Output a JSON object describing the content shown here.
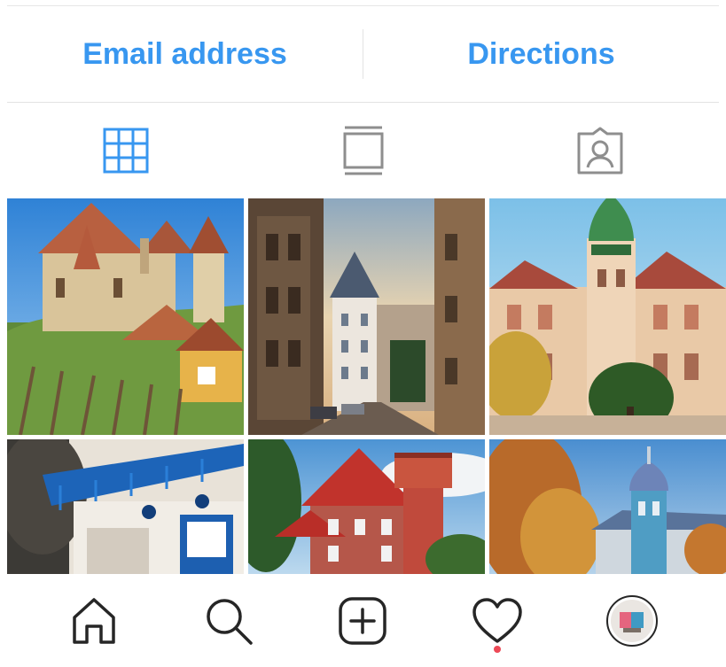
{
  "contact": {
    "email_label": "Email address",
    "directions_label": "Directions"
  },
  "tabs": [
    {
      "name": "grid",
      "icon": "grid-icon",
      "active": true
    },
    {
      "name": "feed",
      "icon": "feed-view-icon",
      "active": false
    },
    {
      "name": "tagged",
      "icon": "tagged-person-icon",
      "active": false
    }
  ],
  "colors": {
    "accent": "#3897f0",
    "icon_inactive": "#8e8e8e",
    "icon_dark": "#262626",
    "notification": "#ed4956"
  },
  "posts": [
    {
      "subject": "fortified-church-village"
    },
    {
      "subject": "narrow-street-tower"
    },
    {
      "subject": "ornate-palace-building"
    },
    {
      "subject": "blue-wooden-house"
    },
    {
      "subject": "red-roof-water-tower"
    },
    {
      "subject": "blue-church-autumn-trees"
    }
  ],
  "bottom_nav": [
    {
      "name": "home",
      "icon": "home-icon"
    },
    {
      "name": "search",
      "icon": "search-icon"
    },
    {
      "name": "new-post",
      "icon": "add-post-icon"
    },
    {
      "name": "activity",
      "icon": "heart-icon",
      "notification": true
    },
    {
      "name": "profile",
      "icon": "avatar"
    }
  ]
}
